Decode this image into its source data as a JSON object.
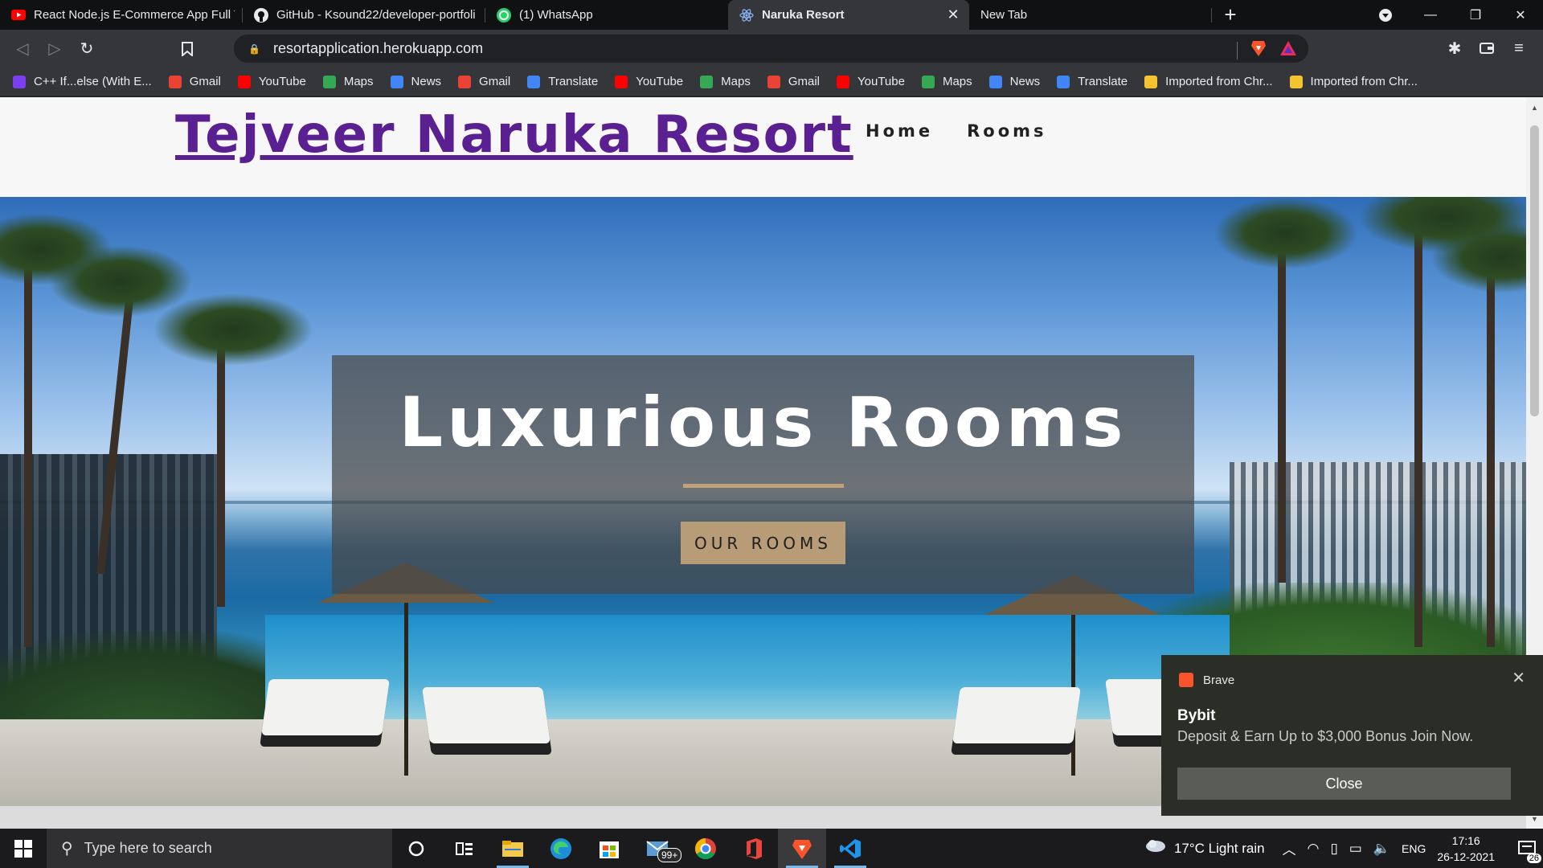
{
  "browser": {
    "tabs": [
      {
        "label": "React Node.js E-Commerce App Full T",
        "icon": "youtube-icon",
        "active": false
      },
      {
        "label": "GitHub - Ksound22/developer-portfoli",
        "icon": "github-icon",
        "active": false
      },
      {
        "label": "(1) WhatsApp",
        "icon": "whatsapp-icon",
        "active": false
      },
      {
        "label": "Naruka Resort",
        "icon": "react-icon",
        "active": true
      },
      {
        "label": "New Tab",
        "icon": "",
        "active": false
      }
    ],
    "url": "resortapplication.herokuapp.com",
    "bookmarks": [
      {
        "label": "C++ If...else (With E...",
        "color": "#7b3ff2"
      },
      {
        "label": "Gmail",
        "color": "#ea4335"
      },
      {
        "label": "YouTube",
        "color": "#ff0000"
      },
      {
        "label": "Maps",
        "color": "#34a853"
      },
      {
        "label": "News",
        "color": "#4285f4"
      },
      {
        "label": "Gmail",
        "color": "#ea4335"
      },
      {
        "label": "Translate",
        "color": "#4285f4"
      },
      {
        "label": "YouTube",
        "color": "#ff0000"
      },
      {
        "label": "Maps",
        "color": "#34a853"
      },
      {
        "label": "Gmail",
        "color": "#ea4335"
      },
      {
        "label": "YouTube",
        "color": "#ff0000"
      },
      {
        "label": "Maps",
        "color": "#34a853"
      },
      {
        "label": "News",
        "color": "#4285f4"
      },
      {
        "label": "Translate",
        "color": "#4285f4"
      },
      {
        "label": "Imported from Chr...",
        "color": "#f4c430"
      },
      {
        "label": "Imported from Chr...",
        "color": "#f4c430"
      }
    ]
  },
  "site": {
    "brand": "Tejveer Naruka Resort",
    "nav": {
      "home": "Home",
      "rooms": "Rooms"
    },
    "hero": {
      "title": "Luxurious Rooms",
      "button": "OUR ROOMS"
    },
    "colors": {
      "brand": "#5a1f91",
      "accent": "#b89b77"
    }
  },
  "notification": {
    "app": "Brave",
    "title": "Bybit",
    "body": "Deposit & Earn Up to $3,000 Bonus Join Now.",
    "close": "Close"
  },
  "taskbar": {
    "search_placeholder": "Type here to search",
    "mail_badge": "99+",
    "weather": "17°C  Light rain",
    "language": "ENG",
    "time": "17:16",
    "date": "26-12-2021",
    "notification_count": "26"
  }
}
